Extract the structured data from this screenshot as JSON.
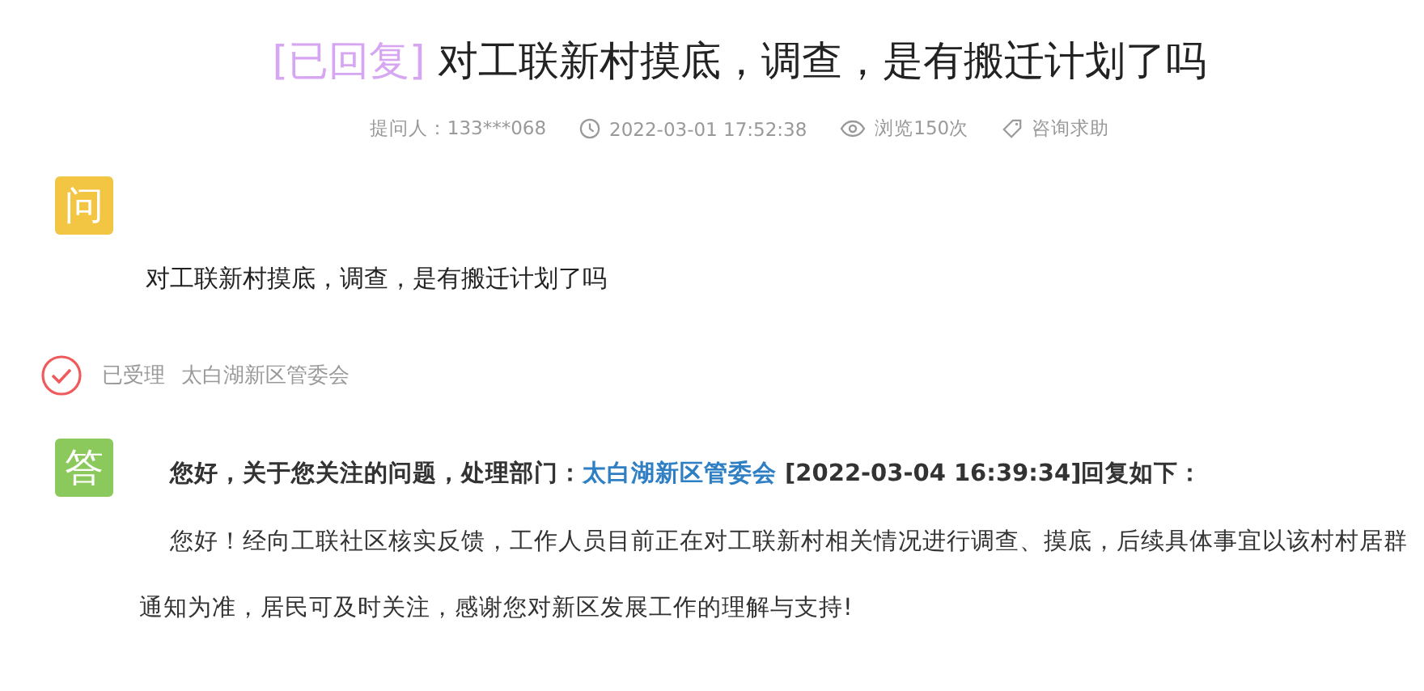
{
  "title": {
    "tag": "[已回复]",
    "text": "对工联新村摸底，调查，是有搬迁计划了吗"
  },
  "meta": {
    "asker": "提问人：133***068",
    "time": "2022-03-01 17:52:38",
    "views": "浏览150次",
    "category": "咨询求助"
  },
  "question": {
    "badge": "问",
    "text": "对工联新村摸底，调查，是有搬迁计划了吗"
  },
  "status": {
    "label": "已受理",
    "dept": "太白湖新区管委会"
  },
  "answer": {
    "badge": "答",
    "intro_before": "您好，关于您关注的问题，处理部门：",
    "dept": "太白湖新区管委会",
    "intro_after": " [2022-03-04 16:39:34]回复如下：",
    "text": "您好！经向工联社区核实反馈，工作人员目前正在对工联新村相关情况进行调查、摸底，后续具体事宜以该村村居群通知为准，居民可及时关注，感谢您对新区发展工作的理解与支持!"
  }
}
